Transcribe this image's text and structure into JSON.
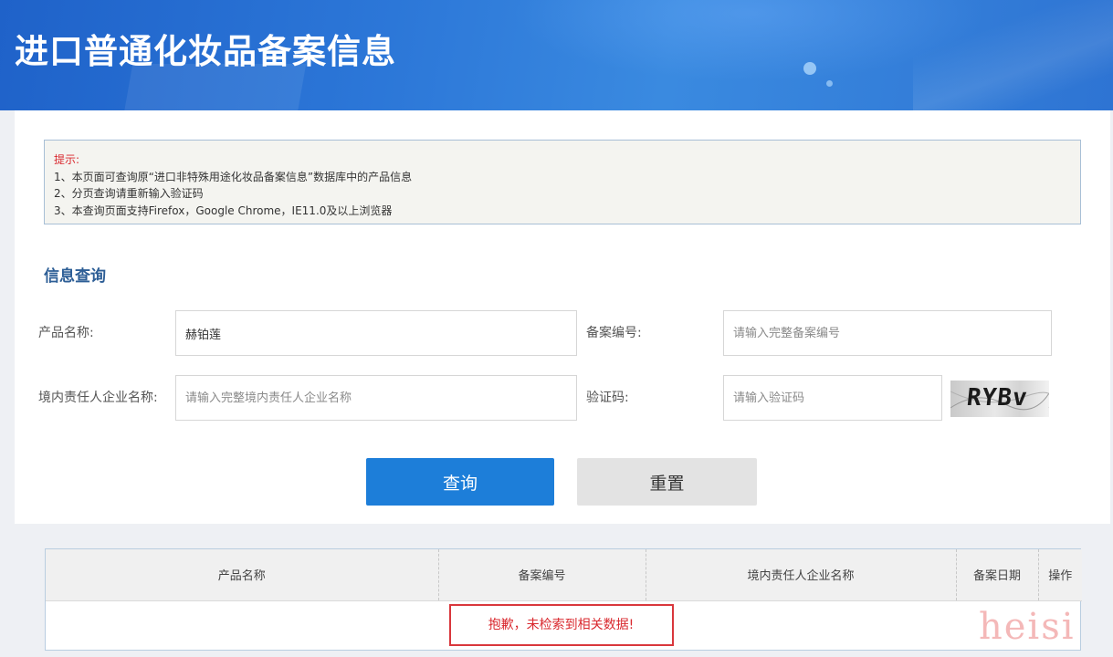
{
  "header": {
    "title": "进口普通化妆品备案信息"
  },
  "notice": {
    "title": "提示:",
    "lines": [
      "1、本页面可查询原“进口非特殊用途化妆品备案信息”数据库中的产品信息",
      "2、分页查询请重新输入验证码",
      "3、本查询页面支持Firefox，Google Chrome，IE11.0及以上浏览器"
    ]
  },
  "search": {
    "section_title": "信息查询",
    "product_name": {
      "label": "产品名称:",
      "value": "赫铂莲",
      "placeholder": ""
    },
    "record_no": {
      "label": "备案编号:",
      "value": "",
      "placeholder": "请输入完整备案编号"
    },
    "company": {
      "label": "境内责任人企业名称:",
      "value": "",
      "placeholder": "请输入完整境内责任人企业名称"
    },
    "captcha": {
      "label": "验证码:",
      "value": "",
      "placeholder": "请输入验证码",
      "image_text": "RYBv"
    },
    "query_label": "查询",
    "reset_label": "重置"
  },
  "results": {
    "columns": [
      "产品名称",
      "备案编号",
      "境内责任人企业名称",
      "备案日期",
      "操作"
    ],
    "empty_message": "抱歉，未检索到相关数据!"
  },
  "watermark": "heisi",
  "colors": {
    "header_blue": "#2c77d8",
    "primary_button": "#1d7ed9",
    "alert_red": "#d9282e",
    "section_title": "#2d5e96"
  }
}
